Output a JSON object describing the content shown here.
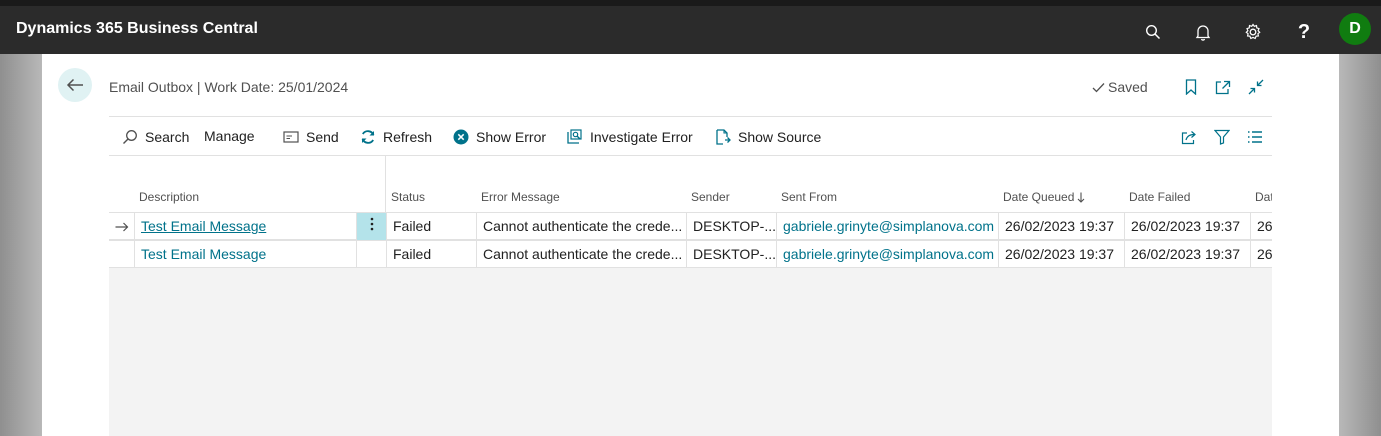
{
  "app": {
    "title": "Dynamics 365 Business Central",
    "avatar_initial": "D",
    "avatar_color": "#107c10"
  },
  "topbar_icons": [
    "search-icon",
    "bell-icon",
    "gear-icon",
    "help-icon"
  ],
  "page": {
    "title": "Email Outbox | Work Date: 25/01/2024",
    "saved_label": "Saved"
  },
  "actions": {
    "search": "Search",
    "manage": "Manage",
    "send": "Send",
    "refresh": "Refresh",
    "show_error": "Show Error",
    "investigate_error": "Investigate Error",
    "show_source": "Show Source"
  },
  "columns": {
    "description": "Description",
    "status": "Status",
    "error_message": "Error Message",
    "sender": "Sender",
    "sent_from": "Sent From",
    "date_queued": "Date Queued",
    "date_failed": "Date Failed",
    "next": "Dat"
  },
  "rows": [
    {
      "description": "Test Email Message",
      "status": "Failed",
      "error_message": "Cannot authenticate the crede...",
      "sender": "DESKTOP-...",
      "sent_from": "gabriele.grinyte@simplanova.com",
      "date_queued": "26/02/2023 19:37",
      "date_failed": "26/02/2023 19:37",
      "next": "26/",
      "selected": true
    },
    {
      "description": "Test Email Message",
      "status": "Failed",
      "error_message": "Cannot authenticate the crede...",
      "sender": "DESKTOP-...",
      "sent_from": "gabriele.grinyte@simplanova.com",
      "date_queued": "26/02/2023 19:37",
      "date_failed": "26/02/2023 19:37",
      "next": "26/",
      "selected": false
    }
  ],
  "colors": {
    "accent": "#00728a",
    "topbar": "#2b2b2b",
    "selected_cell": "#b4e3ea"
  }
}
